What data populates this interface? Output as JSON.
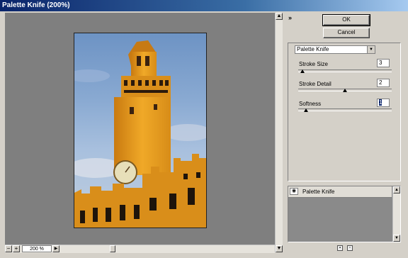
{
  "window": {
    "title": "Palette Knife (200%)"
  },
  "preview": {
    "zoom_label": "200 %",
    "zoom_out": "−",
    "zoom_in": "+"
  },
  "buttons": {
    "ok": "OK",
    "cancel": "Cancel"
  },
  "filter": {
    "selected": "Palette Knife"
  },
  "params": [
    {
      "label": "Stroke Size",
      "value": "3"
    },
    {
      "label": "Stroke Detail",
      "value": "2"
    },
    {
      "label": "Softness",
      "value": "1"
    }
  ],
  "layers": [
    {
      "label": "Palette Knife"
    }
  ],
  "icons": {
    "collapse": "double-chevron-down-icon",
    "eye": "eye-icon",
    "new_layer": "new-effect-layer-icon",
    "delete_layer": "delete-effect-layer-icon"
  }
}
